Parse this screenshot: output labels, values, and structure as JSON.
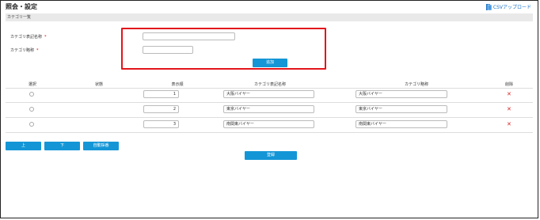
{
  "header": {
    "title": "照会・設定",
    "csv_upload_label": "CSVアップロード"
  },
  "section": {
    "label": "カテゴリ一覧"
  },
  "form": {
    "name_label": "カテゴリ表記名称",
    "code_label": "カテゴリ略称",
    "required_mark": "*",
    "name_value": "",
    "code_value": "",
    "add_button": "追加"
  },
  "table": {
    "headers": [
      "選択",
      "状態",
      "表示順",
      "カテゴリ表記名称",
      "カテゴリ略称",
      "削除"
    ],
    "rows": [
      {
        "order": "1",
        "name": "大阪バイヤー",
        "code": "大阪バイヤー",
        "status": ""
      },
      {
        "order": "2",
        "name": "東京バイヤー",
        "code": "東京バイヤー",
        "status": ""
      },
      {
        "order": "3",
        "name": "南関東バイヤー",
        "code": "南関東バイヤー",
        "status": ""
      }
    ]
  },
  "actions": {
    "up": "上",
    "down": "下",
    "auto_sort": "自動採番",
    "register": "登録"
  },
  "colors": {
    "accent": "#1496d6",
    "highlight": "#e2151b",
    "delete": "#d62020"
  }
}
